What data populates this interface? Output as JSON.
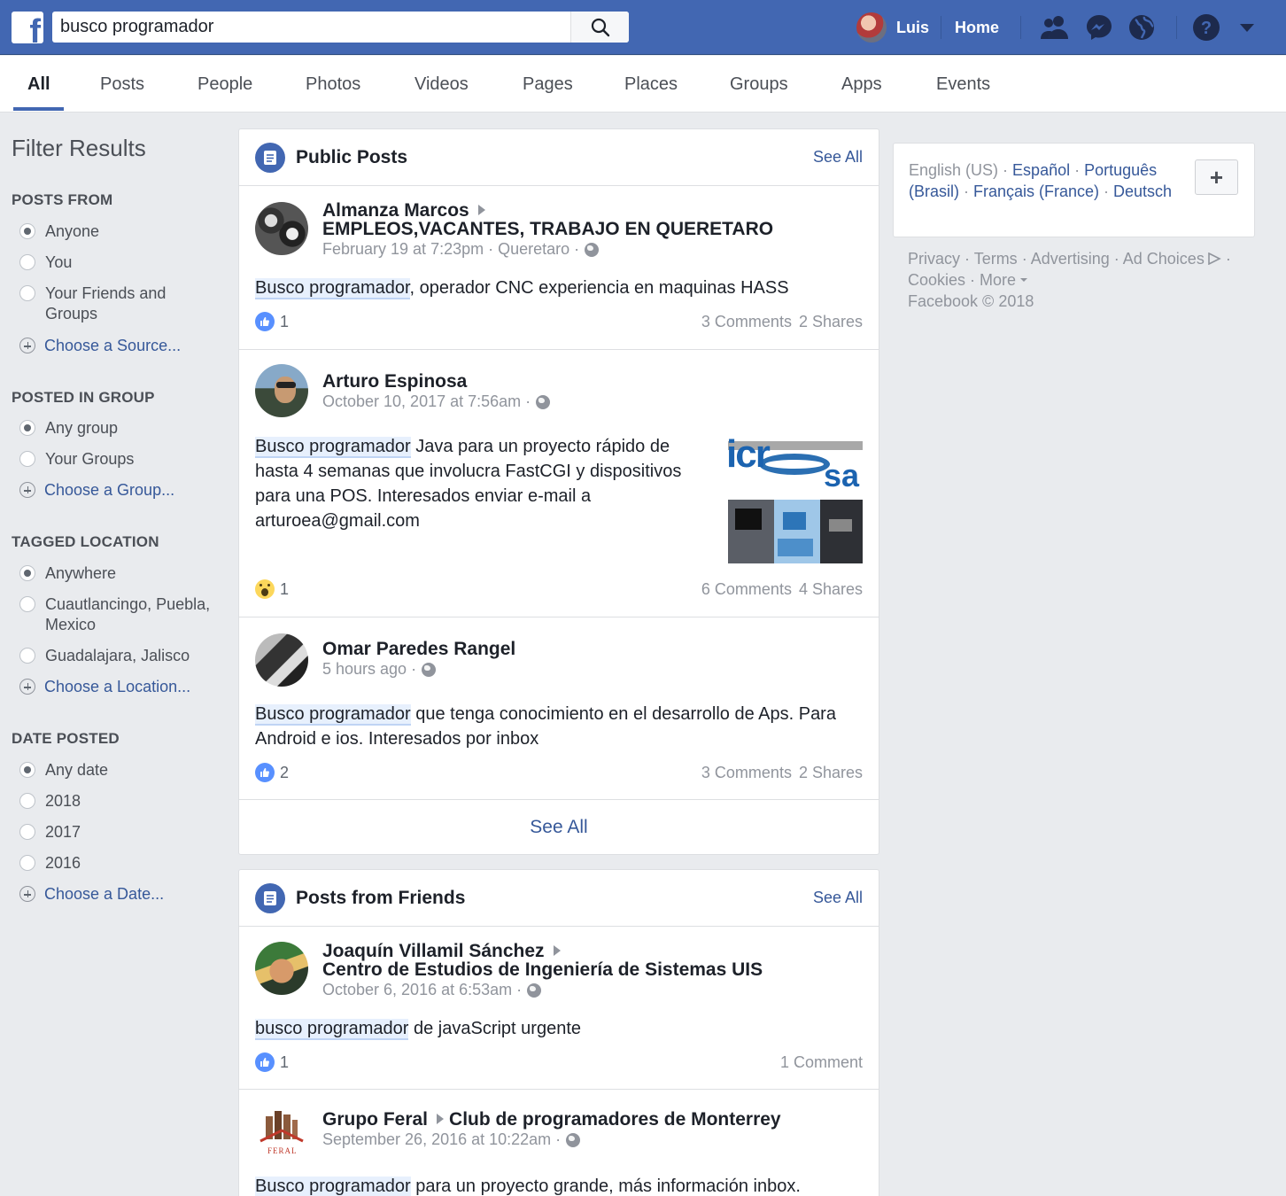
{
  "topbar": {
    "logo": "f",
    "search_value": "busco programador",
    "user_name": "Luis",
    "home_label": "Home"
  },
  "tabs": [
    "All",
    "Posts",
    "People",
    "Photos",
    "Videos",
    "Pages",
    "Places",
    "Groups",
    "Apps",
    "Events"
  ],
  "filters": {
    "title": "Filter Results",
    "posts_from": {
      "heading": "POSTS FROM",
      "options": [
        "Anyone",
        "You",
        "Your Friends and Groups"
      ],
      "choose": "Choose a Source..."
    },
    "posted_in_group": {
      "heading": "POSTED IN GROUP",
      "options": [
        "Any group",
        "Your Groups"
      ],
      "choose": "Choose a Group..."
    },
    "tagged_location": {
      "heading": "TAGGED LOCATION",
      "options": [
        "Anywhere",
        "Cuautlancingo, Puebla, Mexico",
        "Guadalajara, Jalisco"
      ],
      "choose": "Choose a Location..."
    },
    "date_posted": {
      "heading": "DATE POSTED",
      "options": [
        "Any date",
        "2018",
        "2017",
        "2016"
      ],
      "choose": "Choose a Date..."
    }
  },
  "public_posts": {
    "title": "Public Posts",
    "see_all": "See All",
    "footer": "See All",
    "posts": [
      {
        "author": "Almanza Marcos",
        "group": "EMPLEOS,VACANTES, TRABAJO EN QUERETARO",
        "meta": "February 19 at 7:23pm · Queretaro ·",
        "highlight": "Busco programador",
        "text": ", operador CNC experiencia en maquinas HASS",
        "reaction": "1",
        "comments": "3 Comments",
        "shares": "2 Shares"
      },
      {
        "author": "Arturo Espinosa",
        "meta": "October 10, 2017 at 7:56am ·",
        "highlight": "Busco programador",
        "text": " Java para un proyecto rápido de hasta 4 semanas que involucra FastCGI y dispositivos para una POS. Interesados enviar e-mail a arturoea@gmail.com",
        "image_text_1": "icr",
        "image_text_2": "sa",
        "reaction": "1",
        "comments": "6 Comments",
        "shares": "4 Shares"
      },
      {
        "author": "Omar Paredes Rangel",
        "meta": "5 hours ago ·",
        "highlight": "Busco programador",
        "text": " que tenga conocimiento en el desarrollo de Aps. Para Android e ios. Interesados por inbox",
        "reaction": "2",
        "comments": "3 Comments",
        "shares": "2 Shares"
      }
    ]
  },
  "friends_posts": {
    "title": "Posts from Friends",
    "see_all": "See All",
    "posts": [
      {
        "author": "Joaquín Villamil Sánchez",
        "group": "Centro de Estudios de Ingeniería de Sistemas UIS",
        "meta": "October 6, 2016 at 6:53am ·",
        "highlight": "busco programador",
        "text": " de javaScript urgente",
        "reaction": "1",
        "comments": "1 Comment"
      },
      {
        "author": "Grupo Feral",
        "group": "Club de programadores de Monterrey",
        "meta": "September 26, 2016 at 10:22am ·",
        "logo_text": "FERAL",
        "highlight": "Busco programador",
        "text": " para un proyecto grande, más información inbox."
      }
    ]
  },
  "right": {
    "lang_current": "English (US) ·",
    "languages": [
      "Español",
      "Português (Brasil)",
      "Français (France)",
      "Deutsch"
    ],
    "plus": "+",
    "footer": {
      "links": [
        "Privacy",
        "Terms",
        "Advertising",
        "Ad Choices",
        "Cookies",
        "More"
      ],
      "copyright": "Facebook © 2018"
    }
  },
  "colors": {
    "brand": "#4267b2",
    "link": "#365899",
    "highlight_bg": "#e7f0fd",
    "page_bg": "#e9ebee"
  }
}
